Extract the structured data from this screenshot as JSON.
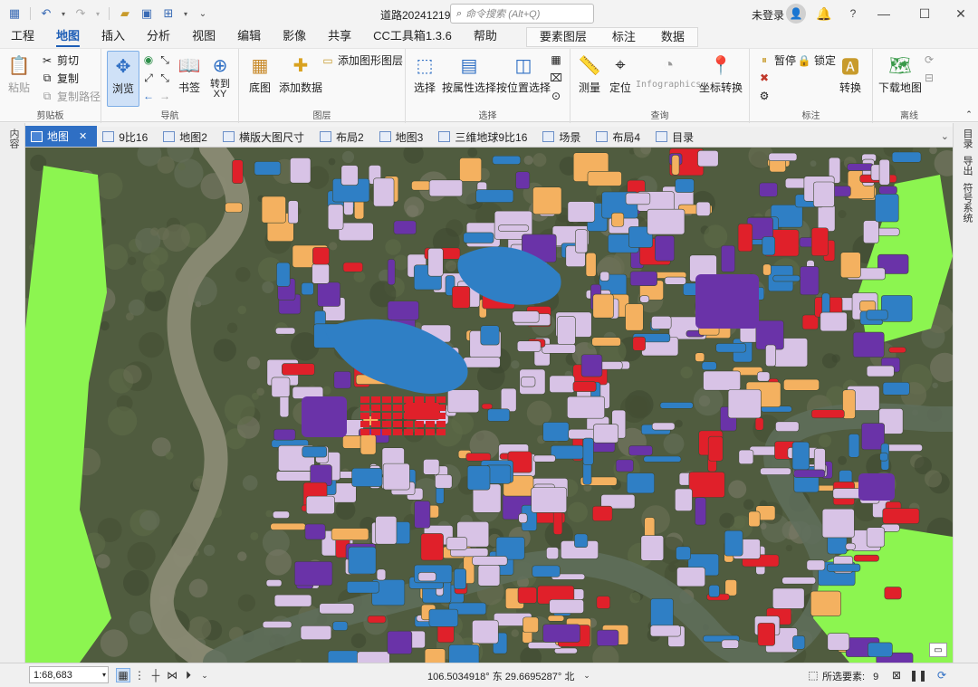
{
  "window": {
    "title": "道路20241219",
    "command_search_placeholder": "命令搜索 (Alt+Q)",
    "user": "未登录"
  },
  "ribbon_tabs": [
    "工程",
    "地图",
    "插入",
    "分析",
    "视图",
    "编辑",
    "影像",
    "共享",
    "CC工具箱1.3.6",
    "帮助"
  ],
  "active_ribbon_tab": "地图",
  "context_tabs": [
    "要素图层",
    "标注",
    "数据"
  ],
  "ribbon": {
    "clipboard": {
      "label": "剪贴板",
      "paste": "粘贴",
      "cut": "剪切",
      "copy": "复制",
      "copy_path": "复制路径"
    },
    "navigate": {
      "label": "导航",
      "explore": "浏览",
      "bookmarks": "书签",
      "goto_xy": "转到\nXY"
    },
    "layer": {
      "label": "图层",
      "basemap": "底图",
      "add_data": "添加数据",
      "add_graphics_layer": "添加图形图层"
    },
    "selection": {
      "label": "选择",
      "select": "选择",
      "select_by_attributes": "按属性选择",
      "select_by_location": "按位置选择"
    },
    "inquiry": {
      "label": "查询",
      "measure": "测量",
      "locate": "定位",
      "infographics": "Infographics",
      "coord_convert": "坐标转换"
    },
    "labeling": {
      "label": "标注",
      "pause": "暂停",
      "lock": "锁定",
      "convert": "转换"
    },
    "offline": {
      "label": "离线",
      "download_map": "下载地图"
    }
  },
  "view_tabs": [
    "地图",
    "9比16",
    "地图2",
    "横版大图尺寸",
    "布局2",
    "地图3",
    "三维地球9比16",
    "场景",
    "布局4",
    "目录"
  ],
  "active_view_tab": "地图",
  "left_pane_label": "内容",
  "right_pane_labels": [
    "目录",
    "导出",
    "符号系统"
  ],
  "status": {
    "scale": "1:68,683",
    "coordinates": "106.5034918° 东 29.6695287° 北",
    "selected_features_label": "所选要素:",
    "selected_features_count": "9"
  },
  "colors": {
    "accent": "#2f6fc4",
    "parcel_lilac": "#d8c3e6",
    "parcel_blue": "#2f7fc5",
    "parcel_purple": "#6a33a8",
    "parcel_red": "#e0202a",
    "parcel_orange": "#f4b160",
    "parcel_green": "#8cf550",
    "river": "#8a8a74"
  }
}
